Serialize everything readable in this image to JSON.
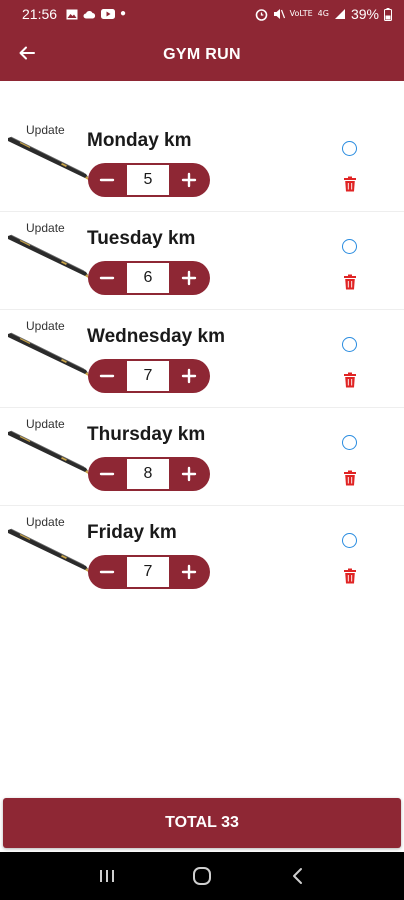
{
  "status_bar": {
    "time": "21:56",
    "left_icons": [
      "photo-icon",
      "weather-icon",
      "youtube-icon",
      "dot-icon"
    ],
    "right_icons": [
      "alarm-icon",
      "mute-icon",
      "volte-icon",
      "signal-icon"
    ],
    "battery": "39%",
    "volte_text": "VoLTE",
    "lte_text": "4G"
  },
  "app_bar": {
    "title": "GYM RUN",
    "back_icon": "back-arrow-icon"
  },
  "entries": [
    {
      "update_label": "Update",
      "day": "Monday km",
      "value": "5"
    },
    {
      "update_label": "Update",
      "day": "Tuesday km",
      "value": "6"
    },
    {
      "update_label": "Update",
      "day": "Wednesday km",
      "value": "7"
    },
    {
      "update_label": "Update",
      "day": "Thursday km",
      "value": "8"
    },
    {
      "update_label": "Update",
      "day": "Friday km",
      "value": "7"
    }
  ],
  "total": {
    "label": "TOTAL 33"
  },
  "colors": {
    "primary": "#8e2734",
    "radio": "#2a8ce0",
    "delete": "#e02424"
  },
  "nav_bar": [
    "recents-icon",
    "home-icon",
    "back-icon"
  ]
}
